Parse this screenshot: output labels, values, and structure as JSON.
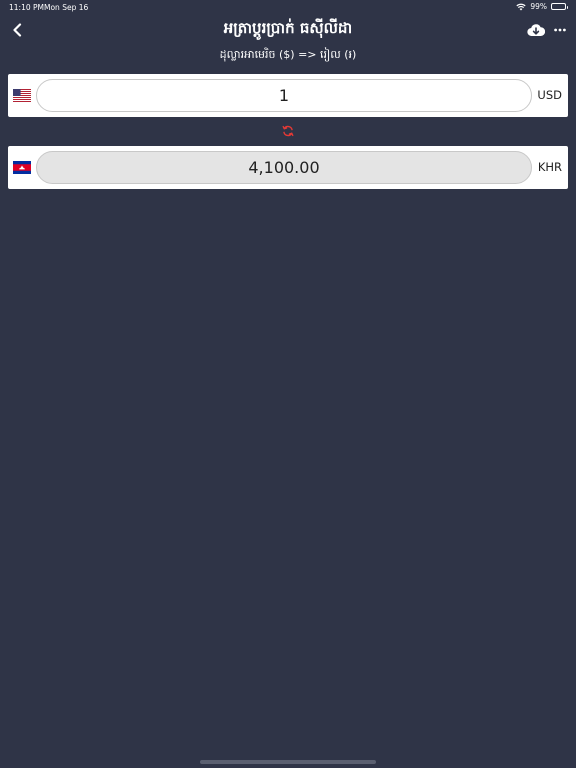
{
  "status_bar": {
    "time": "11:10 PM",
    "date": "Mon Sep 16",
    "battery": "99%",
    "battery_level": 0.99,
    "wifi_icon": "wifi-icon"
  },
  "nav": {
    "title": "អត្រាប្តូរប្រាក់ ធស៊ីលីដា",
    "back_icon": "chevron-left-icon",
    "download_icon": "cloud-download-icon",
    "more_icon": "more-horizontal-icon"
  },
  "subtitle": "ដុល្លារអាមេរិច ($) => រៀល (៛)",
  "from": {
    "flag": "us-flag-icon",
    "value": "1",
    "currency": "USD"
  },
  "swap_icon": "refresh-icon",
  "to": {
    "flag": "cambodia-flag-icon",
    "value": "4,100.00",
    "currency": "KHR"
  },
  "colors": {
    "background": "#2f3447",
    "card": "#ffffff",
    "accent_swap": "#e53935",
    "readonly_field": "#e4e4e4"
  }
}
